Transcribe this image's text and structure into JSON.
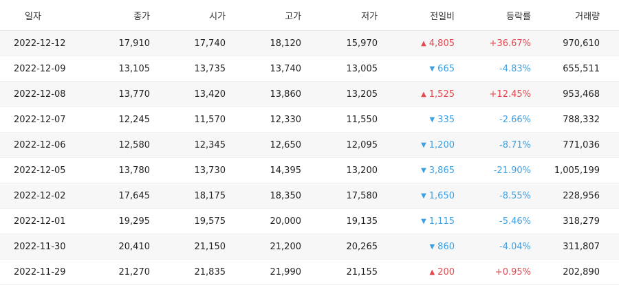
{
  "headers": {
    "date": "일자",
    "close": "종가",
    "open": "시가",
    "high": "고가",
    "low": "저가",
    "change": "전일비",
    "rate": "등락률",
    "volume": "거래량"
  },
  "arrows": {
    "up": "▲",
    "down": "▼"
  },
  "colors": {
    "up": "#e2494f",
    "down": "#3da0e3"
  },
  "rows": [
    {
      "date": "2022-12-12",
      "close": "17,910",
      "open": "17,740",
      "high": "18,120",
      "low": "15,970",
      "dir": "up",
      "change": "4,805",
      "rate": "+36.67%",
      "volume": "970,610"
    },
    {
      "date": "2022-12-09",
      "close": "13,105",
      "open": "13,735",
      "high": "13,740",
      "low": "13,005",
      "dir": "down",
      "change": "665",
      "rate": "-4.83%",
      "volume": "655,511"
    },
    {
      "date": "2022-12-08",
      "close": "13,770",
      "open": "13,420",
      "high": "13,860",
      "low": "13,205",
      "dir": "up",
      "change": "1,525",
      "rate": "+12.45%",
      "volume": "953,468"
    },
    {
      "date": "2022-12-07",
      "close": "12,245",
      "open": "11,570",
      "high": "12,330",
      "low": "11,550",
      "dir": "down",
      "change": "335",
      "rate": "-2.66%",
      "volume": "788,332"
    },
    {
      "date": "2022-12-06",
      "close": "12,580",
      "open": "12,345",
      "high": "12,650",
      "low": "12,095",
      "dir": "down",
      "change": "1,200",
      "rate": "-8.71%",
      "volume": "771,036"
    },
    {
      "date": "2022-12-05",
      "close": "13,780",
      "open": "13,730",
      "high": "14,395",
      "low": "13,200",
      "dir": "down",
      "change": "3,865",
      "rate": "-21.90%",
      "volume": "1,005,199"
    },
    {
      "date": "2022-12-02",
      "close": "17,645",
      "open": "18,175",
      "high": "18,350",
      "low": "17,580",
      "dir": "down",
      "change": "1,650",
      "rate": "-8.55%",
      "volume": "228,956"
    },
    {
      "date": "2022-12-01",
      "close": "19,295",
      "open": "19,575",
      "high": "20,000",
      "low": "19,135",
      "dir": "down",
      "change": "1,115",
      "rate": "-5.46%",
      "volume": "318,279"
    },
    {
      "date": "2022-11-30",
      "close": "20,410",
      "open": "21,150",
      "high": "21,200",
      "low": "20,265",
      "dir": "down",
      "change": "860",
      "rate": "-4.04%",
      "volume": "311,807"
    },
    {
      "date": "2022-11-29",
      "close": "21,270",
      "open": "21,835",
      "high": "21,990",
      "low": "21,155",
      "dir": "up",
      "change": "200",
      "rate": "+0.95%",
      "volume": "202,890"
    }
  ]
}
